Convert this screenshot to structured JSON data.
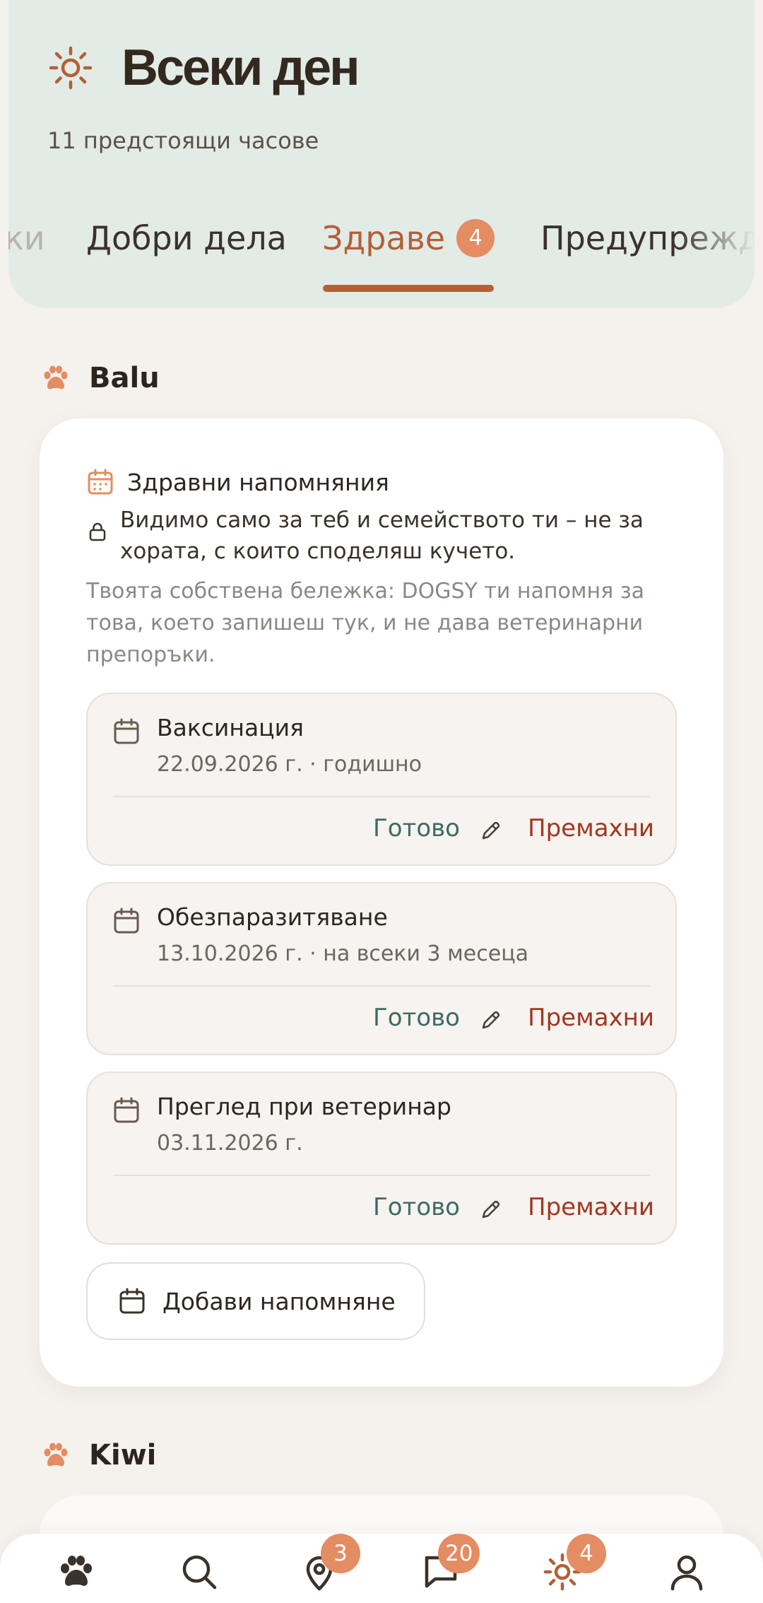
{
  "header": {
    "title": "Всеки ден",
    "subtitle": "11 предстоящи часове"
  },
  "tabs": {
    "partial_left": "ки",
    "items": [
      {
        "label": "Добри дела"
      },
      {
        "label": "Здраве",
        "badge": "4",
        "active": true
      },
      {
        "label": "Предупрежд"
      }
    ]
  },
  "sections": [
    {
      "dog_name": "Balu",
      "card": {
        "title": "Здравни напомняния",
        "privacy": "Видимо само за теб и семейството ти – не за хората, с които споделяш кучето.",
        "note": "Твоята собствена бележка: DOGSY ти напомня за това, което запишеш тук, и не дава ветеринарни препоръки.",
        "reminders": [
          {
            "title": "Ваксинация",
            "date": "22.09.2026 г. · годишно",
            "done": "Готово",
            "remove": "Премахни"
          },
          {
            "title": "Обезпаразитяване",
            "date": "13.10.2026 г. · на всеки 3 месеца",
            "done": "Готово",
            "remove": "Премахни"
          },
          {
            "title": "Преглед при ветеринар",
            "date": "03.11.2026 г.",
            "done": "Готово",
            "remove": "Премахни"
          }
        ],
        "add_label": "Добави напомняне"
      }
    },
    {
      "dog_name": "Kiwi"
    }
  ],
  "bottom_nav": {
    "items": [
      {
        "icon": "paw-icon"
      },
      {
        "icon": "search-icon"
      },
      {
        "icon": "location-pin-icon",
        "badge": "3"
      },
      {
        "icon": "chat-icon",
        "badge": "20"
      },
      {
        "icon": "sun-icon",
        "badge": "4",
        "active": true
      },
      {
        "icon": "profile-icon"
      }
    ]
  },
  "colors": {
    "accent": "#b45f36",
    "badge": "#e48c62",
    "done": "#3d6a62",
    "remove": "#a0381f",
    "header_bg": "#e3ebe6"
  }
}
